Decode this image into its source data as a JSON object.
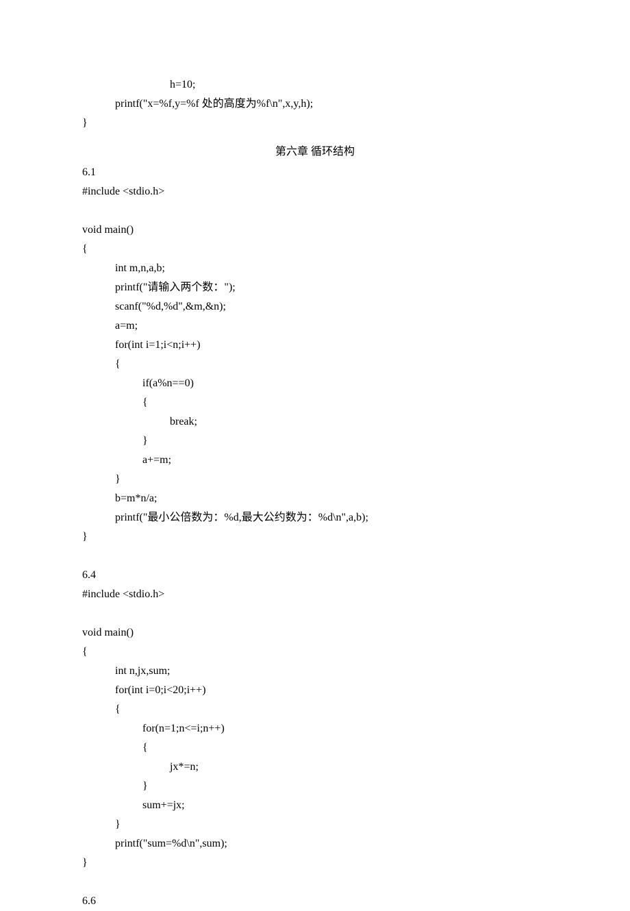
{
  "codeTop": {
    "line1": "h=10;",
    "line2": "printf(\"x=%f,y=%f 处的高度为%f\\n\",x,y,h);",
    "closeBrace": "}"
  },
  "chapterHeading": "第六章  循环结构",
  "section61": {
    "label": "6.1",
    "include": "#include <stdio.h>",
    "funcDecl": "void main()",
    "openBrace": "{",
    "decl": "int m,n,a,b;",
    "printf1": "printf(\"请输入两个数：\");",
    "scanf": "scanf(\"%d,%d\",&m,&n);",
    "assign1": "a=m;",
    "forLine": "for(int i=1;i<n;i++)",
    "forOpen": "{",
    "ifLine": "if(a%n==0)",
    "ifOpen": "{",
    "breakLine": "break;",
    "ifClose": "}",
    "aPlus": "a+=m;",
    "forClose": "}",
    "bAssign": "b=m*n/a;",
    "printf2": "printf(\"最小公倍数为：%d,最大公约数为：%d\\n\",a,b);",
    "closeBrace": "}"
  },
  "section64": {
    "label": "6.4",
    "include": "#include <stdio.h>",
    "funcDecl": "void main()",
    "openBrace": "{",
    "decl": "int n,jx,sum;",
    "forLine": "for(int i=0;i<20;i++)",
    "forOpen": "{",
    "innerFor": "for(n=1;n<=i;n++)",
    "innerOpen": "{",
    "jxLine": "jx*=n;",
    "innerClose": "}",
    "sumLine": "sum+=jx;",
    "forClose": "}",
    "printf": "printf(\"sum=%d\\n\",sum);",
    "closeBrace": "}"
  },
  "section66": {
    "label": "6.6"
  }
}
